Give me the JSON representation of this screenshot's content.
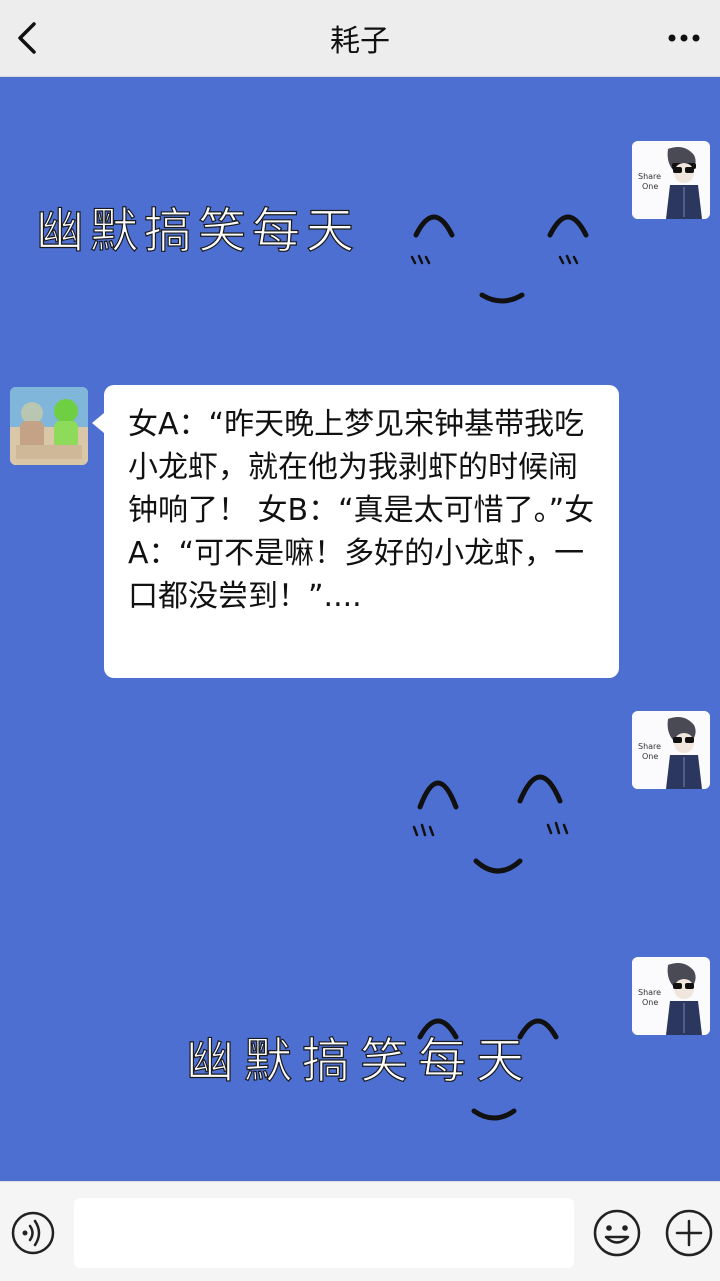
{
  "header": {
    "title": "耗子",
    "back_icon": "chevron-left-icon",
    "more_icon": "ellipsis-icon"
  },
  "messages": [
    {
      "side": "right",
      "type": "sticker",
      "text": "幽默搞笑每天",
      "sender": "self"
    },
    {
      "side": "left",
      "type": "text",
      "sender": "contact",
      "text": "女A：“昨天晚上梦见宋钟基带我吃小龙虾，就在他为我剥虾的时候闹钟响了！ 女B：“真是太可惜了。”女A：“可不是嘛！多好的小龙虾，一口都没尝到！”...."
    },
    {
      "side": "right",
      "type": "sticker",
      "text": "",
      "sender": "self"
    },
    {
      "side": "right",
      "type": "sticker",
      "text": "幽默搞笑每天",
      "sender": "self"
    }
  ],
  "self_avatar": {
    "caption_line1": "Share",
    "caption_line2": "One"
  },
  "input_bar": {
    "voice_icon": "voice-icon",
    "emoji_icon": "emoji-icon",
    "plus_icon": "plus-icon",
    "placeholder": ""
  },
  "colors": {
    "chat_background": "#4d6fd1",
    "header_background": "#ededed",
    "bubble": "#ffffff"
  }
}
